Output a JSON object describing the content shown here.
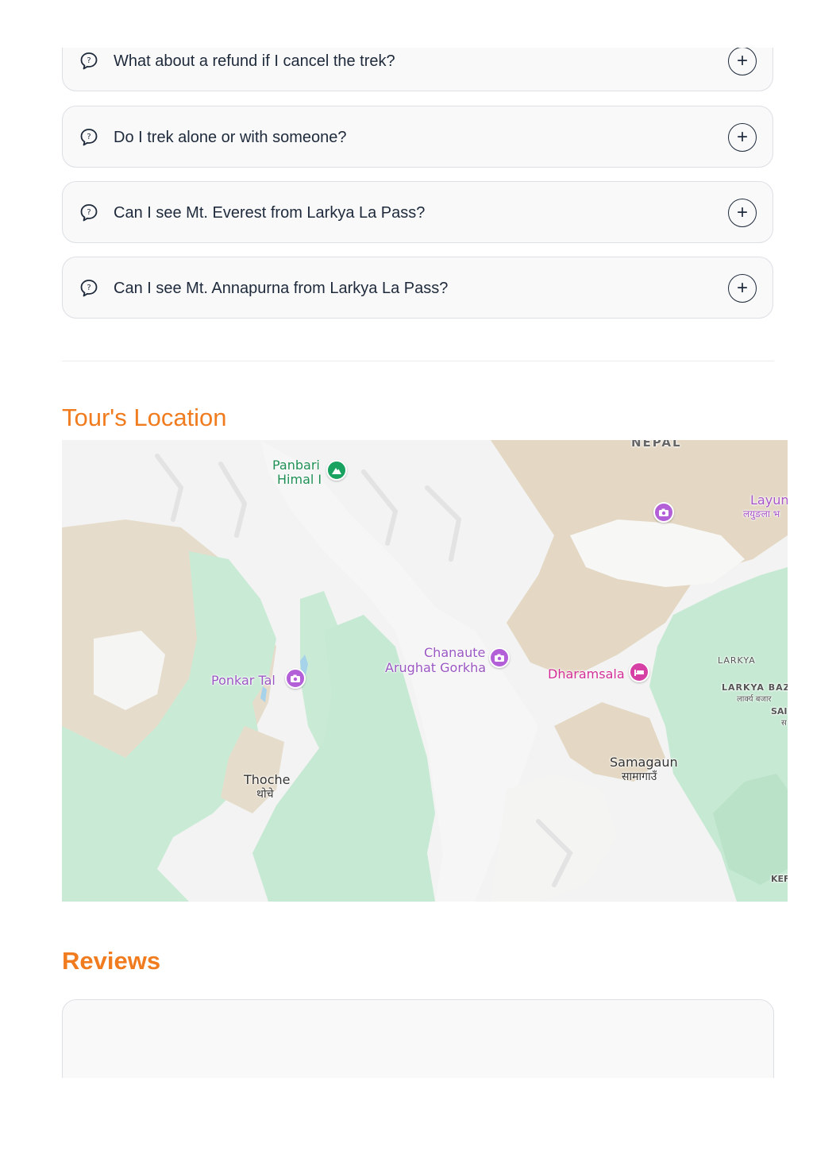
{
  "faq": {
    "items": [
      {
        "question": "What about a refund if I cancel the trek?",
        "toggle": "+"
      },
      {
        "question": "Do I trek alone or with someone?",
        "toggle": "+"
      },
      {
        "question": "Can I see Mt. Everest from Larkya La Pass?",
        "toggle": "+"
      },
      {
        "question": "Can I see Mt. Annapurna from Larkya La Pass?",
        "toggle": "+"
      }
    ],
    "icon": "question-bubble-icon"
  },
  "location": {
    "title": "Tour's Location",
    "map": {
      "labels": {
        "nepal": "NEPAL",
        "panbari_1": "Panbari",
        "panbari_2": "Himal I",
        "layun_1": "Layun",
        "layun_2": "लयुङला भ",
        "chanaute_1": "Chanaute",
        "chanaute_2": "Arughat Gorkha",
        "dharamsala": "Dharamsala",
        "ponkar": "Ponkar Tal",
        "larkya": "LARKYA",
        "larkya_bazar_1": "LARKYA BAZA",
        "larkya_bazar_2": "लार्क्य बजार",
        "sa_1": "SAI",
        "sa_2": "स",
        "thoche_1": "Thoche",
        "thoche_2": "थोचे",
        "samagaun_1": "Samagaun",
        "samagaun_2": "सामागाउँ",
        "ker": "KEF"
      },
      "colors": {
        "snow": "#f2f3f2",
        "rock": "#e3d7c3",
        "forest": "#c6e9d3",
        "water": "#a6d2ea",
        "pin_camera": "#b35fd8",
        "pin_peak": "#1aa260",
        "pin_lodging": "#d63fa3"
      }
    }
  },
  "reviews": {
    "title": "Reviews"
  },
  "colors": {
    "accent": "#f07c1f",
    "card_bg": "#f9f9f9",
    "card_border": "#dcdfe4",
    "text": "#1e2a3b"
  }
}
